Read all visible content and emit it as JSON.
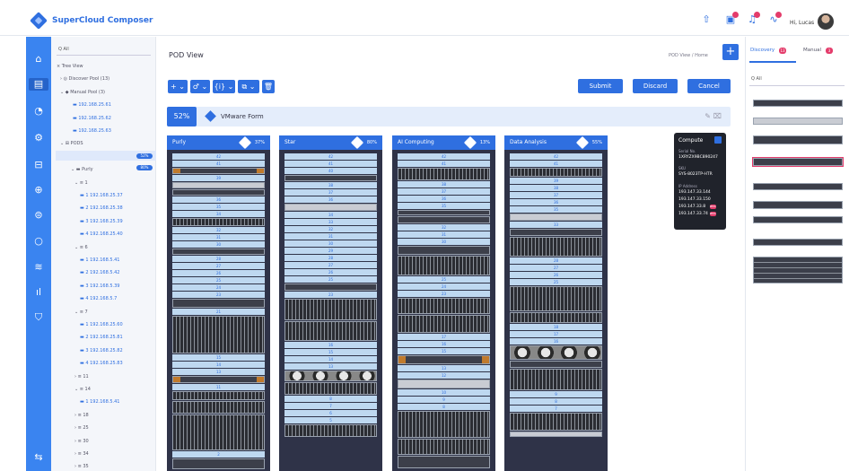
{
  "app": {
    "title": "SuperCloud Composer",
    "greeting": "Hi, Lucas"
  },
  "topbar": {
    "icons": [
      "upload-icon",
      "clipboard-icon",
      "bell-icon",
      "activity-icon"
    ]
  },
  "rail": {
    "icons": [
      "home-icon",
      "server-icon",
      "cloud-icon",
      "settings-icon",
      "lock-icon",
      "globe-icon",
      "database-icon",
      "circle-icon",
      "layers-icon",
      "chart-icon",
      "shield-icon",
      "bottom-icon"
    ]
  },
  "tree": {
    "search": "Q All",
    "items": [
      {
        "label": "⨯ Tree View",
        "blue": false
      },
      {
        "label": "› ◎ Discover Pool (13)",
        "blue": false
      },
      {
        "label": "⌄ ◆ Manual Pool (3)",
        "blue": false
      },
      {
        "label": "▬ 192.168.25.61",
        "blue": true
      },
      {
        "label": "▬ 192.168.25.62",
        "blue": true
      },
      {
        "label": "▬ 192.168.25.63",
        "blue": true
      },
      {
        "label": "⌄ ⊞ PODS",
        "blue": false
      },
      {
        "label": "⌄ ⨯ VMware Form",
        "blue": false
      },
      {
        "label": "⌄ ▬ Purly",
        "blue": false
      },
      {
        "label": "⌄ ≡ 1",
        "blue": false
      },
      {
        "label": "▬ 1 192.168.25.37",
        "blue": true
      },
      {
        "label": "▬ 2 192.168.25.38",
        "blue": true
      },
      {
        "label": "▬ 3 192.168.25.39",
        "blue": true
      },
      {
        "label": "▬ 4 192.168.25.40",
        "blue": true
      },
      {
        "label": "⌄ ≡ 6",
        "blue": false
      },
      {
        "label": "▬ 1 192.168.5.41",
        "blue": true
      },
      {
        "label": "▬ 2 192.168.5.42",
        "blue": true
      },
      {
        "label": "▬ 3 192.168.5.39",
        "blue": true
      },
      {
        "label": "▬ 4 192.168.5.7",
        "blue": true
      },
      {
        "label": "⌄ ≡ 7",
        "blue": false
      },
      {
        "label": "▬ 1 192.168.25.60",
        "blue": true
      },
      {
        "label": "▬ 2 192.168.25.81",
        "blue": true
      },
      {
        "label": "▬ 3 192.168.25.82",
        "blue": true
      },
      {
        "label": "▬ 4 192.168.25.83",
        "blue": true
      },
      {
        "label": "› ≡ 11",
        "blue": false
      },
      {
        "label": "⌄ ≡ 14",
        "blue": false
      },
      {
        "label": "▬ 1 192.168.5.41",
        "blue": true
      },
      {
        "label": "› ≡ 18",
        "blue": false
      },
      {
        "label": "› ≡ 25",
        "blue": false
      },
      {
        "label": "› ≡ 30",
        "blue": false
      },
      {
        "label": "› ≡ 34",
        "blue": false
      },
      {
        "label": "› ≡ 35",
        "blue": false
      }
    ],
    "pills": [
      "52%",
      "80%"
    ]
  },
  "main": {
    "title": "POD View",
    "breadcrumb": "POD View / Home",
    "plus": "+",
    "tools": [
      "+ ⌄",
      "♂ ⌄",
      "{i} ⌄",
      "⧉ ⌄",
      "🗑"
    ],
    "submit": "Submit",
    "discard": "Discard",
    "cancel": "Cancel",
    "pod": {
      "percent": "52%",
      "name": "VMware Form"
    },
    "racks": [
      {
        "name": "Purly",
        "percent": "37%"
      },
      {
        "name": "Star",
        "percent": "80%"
      },
      {
        "name": "AI Computing",
        "percent": "13%"
      },
      {
        "name": "Data Analysis",
        "percent": "55%"
      }
    ]
  },
  "tooltip": {
    "title": "Compute",
    "serial_label": "Serial No.",
    "serial": "1XRYZX9BC890247",
    "sku_label": "SKU",
    "sku": "SYS-8023TP-HTR",
    "ip_label": "IP Address",
    "ips": [
      "193.147.33.144",
      "193.147.33.150",
      "193.147.33.8",
      "193.147.33.74"
    ],
    "tags": [
      "BMC",
      "BMC"
    ]
  },
  "right": {
    "tab_discovery": "Discovery",
    "discovery_count": "13",
    "tab_manual": "Manual",
    "manual_count": "3",
    "search": "Q All"
  }
}
